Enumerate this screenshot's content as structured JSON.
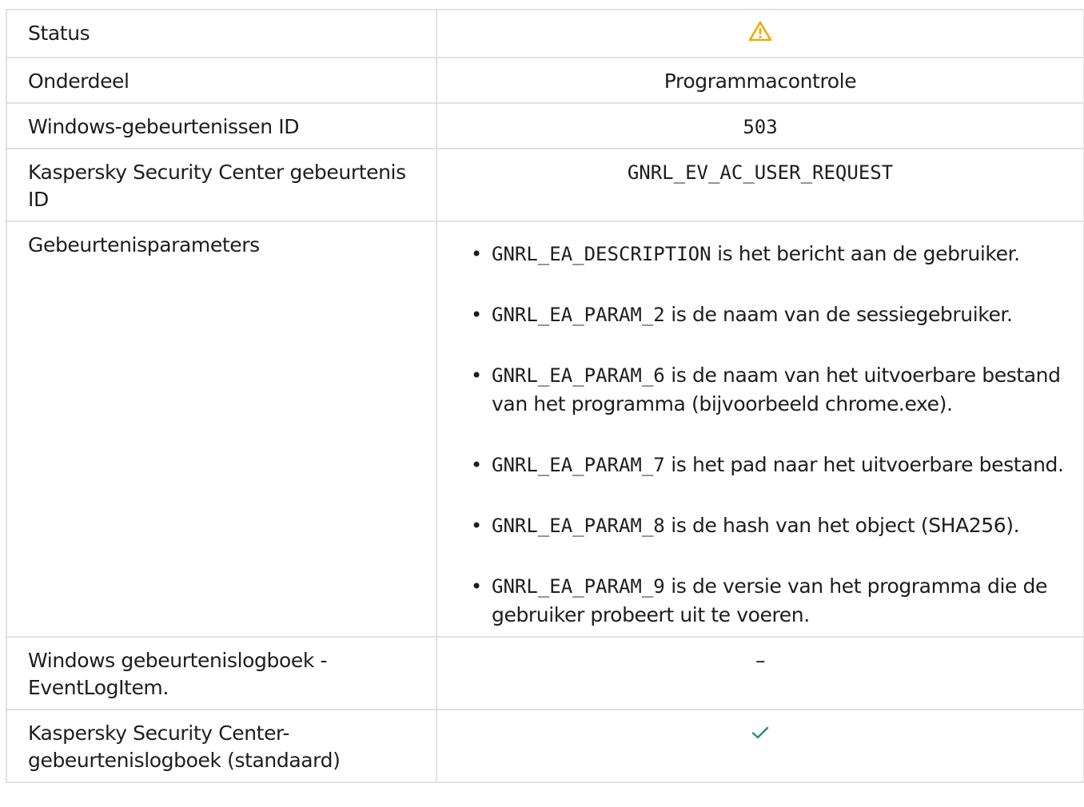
{
  "rows": {
    "status": {
      "key": "Status",
      "icon": "warning-icon"
    },
    "component": {
      "key": "Onderdeel",
      "value": "Programmacontrole"
    },
    "windows_event_id": {
      "key": "Windows-gebeurtenissen ID",
      "value": "503"
    },
    "ksc_event_id": {
      "key": "Kaspersky Security Center gebeurtenis ID",
      "value": "GNRL_EV_AC_USER_REQUEST"
    },
    "parameters": {
      "key": "Gebeurtenisparameters",
      "items": [
        {
          "code": "GNRL_EA_DESCRIPTION",
          "text": " is het bericht aan de gebruiker."
        },
        {
          "code": "GNRL_EA_PARAM_2",
          "text": " is de naam van de sessiegebruiker."
        },
        {
          "code": "GNRL_EA_PARAM_6",
          "text": " is de naam van het uitvoerbare bestand van het programma (bijvoorbeeld chrome.exe)."
        },
        {
          "code": "GNRL_EA_PARAM_7",
          "text": " is het pad naar het uitvoerbare bestand."
        },
        {
          "code": "GNRL_EA_PARAM_8",
          "text": " is de hash van het object (SHA256)."
        },
        {
          "code": "GNRL_EA_PARAM_9",
          "text": " is de versie van het programma die de gebruiker probeert uit te voeren."
        }
      ]
    },
    "windows_log": {
      "key": "Windows gebeurtenislogboek - EventLogItem.",
      "value": "–"
    },
    "ksc_log": {
      "key": "Kaspersky Security Center-gebeurtenislogboek (standaard)",
      "icon": "checkmark-icon"
    }
  },
  "colors": {
    "border": "#e2e2e2",
    "warning": "#f2a900",
    "check": "#2e8b7a",
    "text": "#1d1d1b"
  }
}
